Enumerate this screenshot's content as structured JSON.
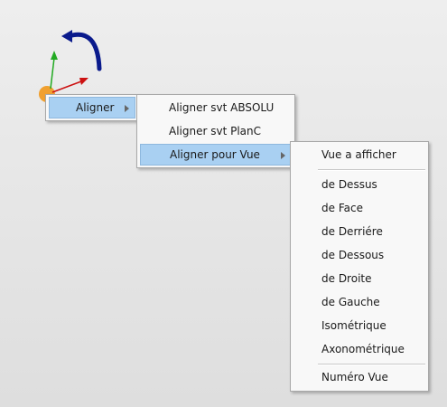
{
  "menu1": {
    "items": [
      {
        "label": "Aligner"
      }
    ]
  },
  "menu2": {
    "items": [
      {
        "label": "Aligner svt ABSOLU"
      },
      {
        "label": "Aligner svt PlanC"
      },
      {
        "label": "Aligner pour Vue"
      }
    ]
  },
  "menu3": {
    "header": "Vue a afficher",
    "items": [
      {
        "label": "de Dessus"
      },
      {
        "label": "de Face"
      },
      {
        "label": "de Derriére"
      },
      {
        "label": "de Dessous"
      },
      {
        "label": "de Droite"
      },
      {
        "label": "de Gauche"
      },
      {
        "label": "Isométrique"
      },
      {
        "label": "Axonométrique"
      }
    ],
    "footer": "Numéro Vue"
  },
  "colors": {
    "highlight": "#a9d0f2",
    "axis_x": "#cc1111",
    "axis_y": "#22aa22",
    "rotate_arrow": "#0a1a8c",
    "origin": "#f0a030"
  },
  "icons": [
    "axis-x-arrow-icon",
    "axis-y-arrow-icon",
    "rotate-arrow-icon",
    "origin-sphere-icon"
  ]
}
